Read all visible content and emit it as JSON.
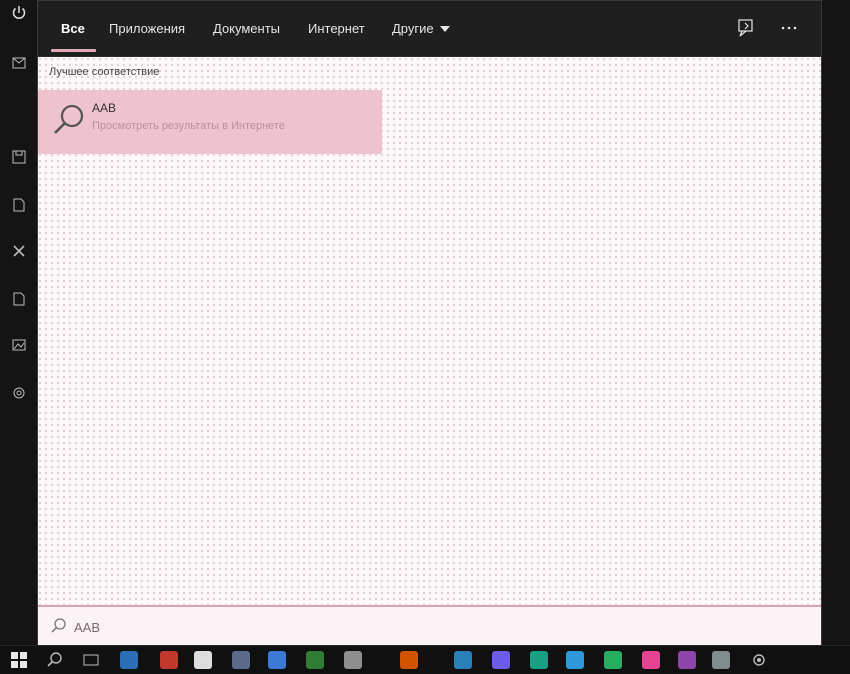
{
  "tabs": [
    {
      "label": "Все",
      "active": true
    },
    {
      "label": "Приложения",
      "active": false
    },
    {
      "label": "Документы",
      "active": false
    },
    {
      "label": "Интернет",
      "active": false
    },
    {
      "label": "Другие",
      "active": false
    }
  ],
  "toolbar": {
    "feedback_icon": "feedback-icon",
    "more_icon": "more-icon"
  },
  "results": {
    "section_title": "Лучшее соответствие",
    "best_match": {
      "title": "AAB",
      "subtitle": "Просмотреть результаты в Интернете",
      "icon": "search-icon"
    }
  },
  "search": {
    "value": "AAB",
    "placeholder": ""
  },
  "colors": {
    "accent": "#e1a9b6",
    "selection": "#efc3cd",
    "panel": "#fcf7f9",
    "topbar": "#1f1f1f"
  }
}
